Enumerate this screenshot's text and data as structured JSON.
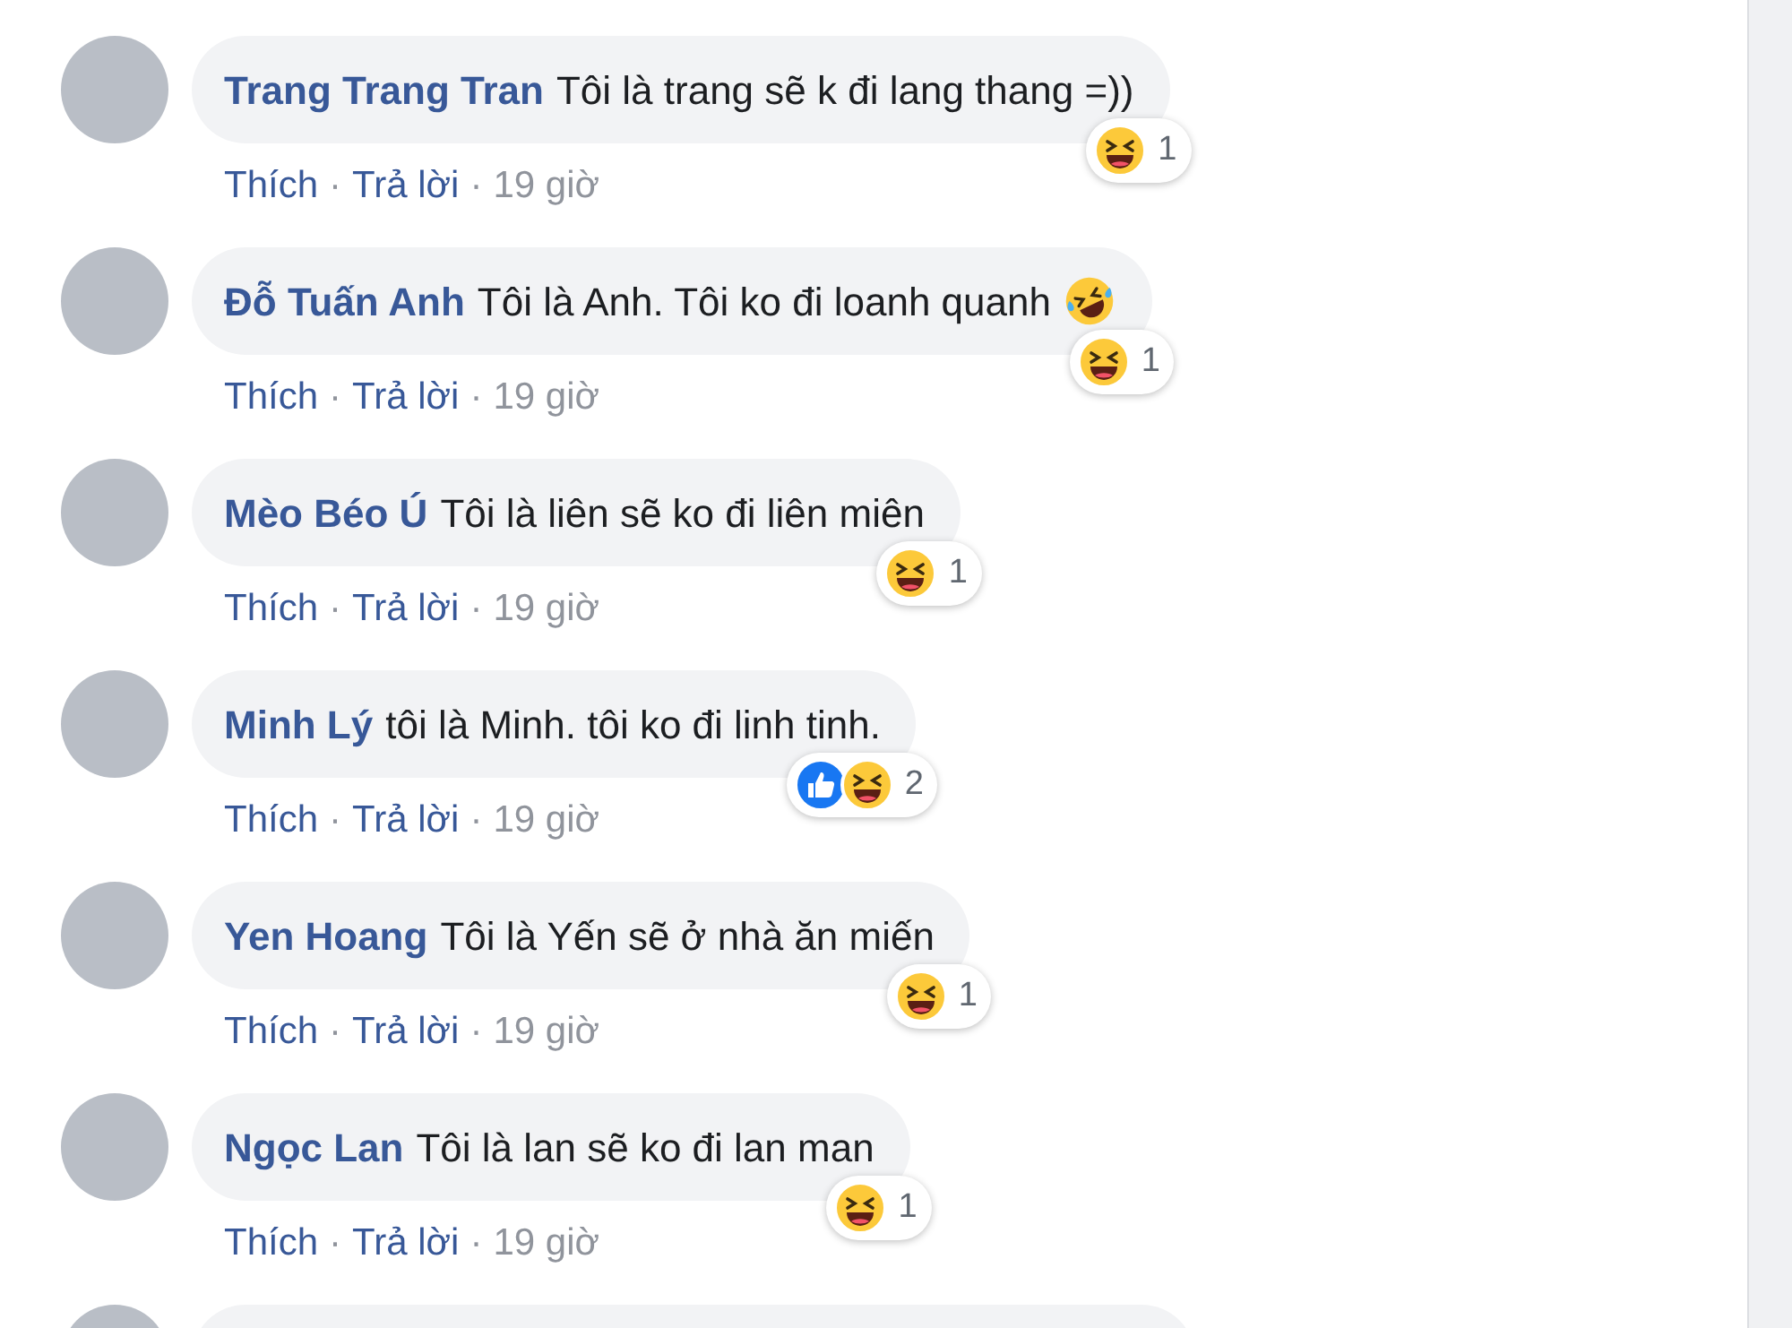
{
  "comments": [
    {
      "author": "Trang Trang Tran",
      "text": "Tôi là trang sẽ k đi lang thang =))",
      "rolling_laugh_emoji": false,
      "reactions": {
        "items": [
          {
            "kind": "haha"
          }
        ],
        "count": "1"
      },
      "actions": [
        "Thích",
        "Trả lời"
      ],
      "separator": "·",
      "time": "19 giờ"
    },
    {
      "author": "Đỗ Tuấn Anh",
      "text": "Tôi là Anh. Tôi ko đi loanh quanh",
      "rolling_laugh_emoji": true,
      "reactions": {
        "items": [
          {
            "kind": "haha"
          }
        ],
        "count": "1"
      },
      "actions": [
        "Thích",
        "Trả lời"
      ],
      "separator": "·",
      "time": "19 giờ"
    },
    {
      "author": "Mèo Béo Ú",
      "text": "Tôi là liên sẽ ko đi liên miên",
      "rolling_laugh_emoji": false,
      "reactions": {
        "items": [
          {
            "kind": "haha"
          }
        ],
        "count": "1"
      },
      "actions": [
        "Thích",
        "Trả lời"
      ],
      "separator": "·",
      "time": "19 giờ"
    },
    {
      "author": "Minh Lý",
      "text": "tôi là Minh. tôi ko đi linh tinh.",
      "rolling_laugh_emoji": false,
      "reactions": {
        "items": [
          {
            "kind": "like"
          },
          {
            "kind": "haha"
          }
        ],
        "count": "2"
      },
      "actions": [
        "Thích",
        "Trả lời"
      ],
      "separator": "·",
      "time": "19 giờ"
    },
    {
      "author": "Yen Hoang",
      "text": "Tôi là Yến sẽ ở nhà ăn miến",
      "rolling_laugh_emoji": false,
      "reactions": {
        "items": [
          {
            "kind": "haha"
          }
        ],
        "count": "1"
      },
      "actions": [
        "Thích",
        "Trả lời"
      ],
      "separator": "·",
      "time": "19 giờ"
    },
    {
      "author": "Ngọc Lan",
      "text": "Tôi là lan sẽ ko đi lan man",
      "rolling_laugh_emoji": false,
      "reactions": {
        "items": [
          {
            "kind": "haha"
          }
        ],
        "count": "1"
      },
      "actions": [
        "Thích",
        "Trả lời"
      ],
      "separator": "·",
      "time": "19 giờ"
    }
  ],
  "more_below": true
}
